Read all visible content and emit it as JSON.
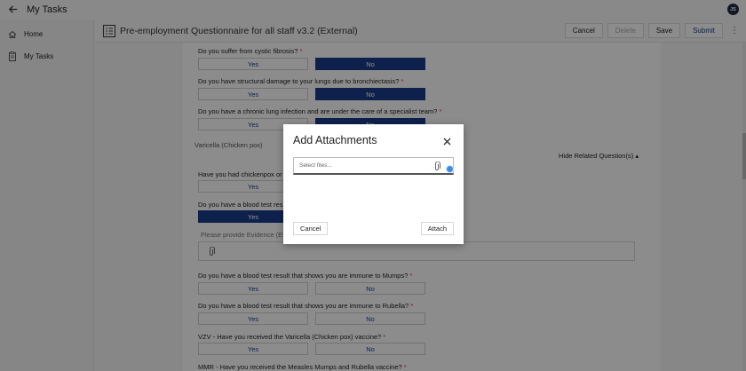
{
  "topbar": {
    "title": "My Tasks",
    "avatar_initials": "JS"
  },
  "sidebar": {
    "items": [
      {
        "label": "Home",
        "icon": "home-icon"
      },
      {
        "label": "My Tasks",
        "icon": "clipboard-icon"
      }
    ]
  },
  "header": {
    "form_title": "Pre-employment Questionnaire for all staff v3.2 (External)",
    "buttons": {
      "cancel": "Cancel",
      "delete": "Delete",
      "save": "Save",
      "submit": "Submit"
    }
  },
  "form": {
    "questions": [
      {
        "text": "Do you suffer from cystic fibrosis?",
        "required": "*",
        "yes": "Yes",
        "no": "No",
        "selected": "no"
      },
      {
        "text": "Do you have structural damage to your lungs due to bronchiectasis?",
        "required": "*",
        "yes": "Yes",
        "no": "No",
        "selected": "no"
      },
      {
        "text": "Do you have a chronic lung infection and are under the care of a specialist team?",
        "required": "*",
        "yes": "Yes",
        "no": "No",
        "selected": "no"
      },
      {
        "text": "Have you had chickenpox or s",
        "required": "",
        "yes": "Yes",
        "no": "No",
        "selected": "none"
      },
      {
        "text": "Do you have a blood test resul",
        "required": "",
        "yes": "Yes",
        "no": "No",
        "selected": "yes"
      },
      {
        "text": "Do you have a blood test result that shows you are immune to Mumps?",
        "required": "*",
        "yes": "Yes",
        "no": "No",
        "selected": "none"
      },
      {
        "text": "Do you have a blood test result that shows you are immune to Rubella?",
        "required": "*",
        "yes": "Yes",
        "no": "No",
        "selected": "none"
      },
      {
        "text": "VZV - Have you received the Varicella (Chicken pox) vaccine?",
        "required": "*",
        "yes": "Yes",
        "no": "No",
        "selected": "none"
      },
      {
        "text": "MMR - Have you received the Measles Mumps and Rubella vaccine?",
        "required": "*"
      }
    ],
    "section_label": "Varicella (Chicken pox)",
    "hide_related": "Hide Related Question(s)",
    "evidence_label": "Please provide Evidence (Eve"
  },
  "modal": {
    "title": "Add Attachments",
    "placeholder": "Select files...",
    "cancel": "Cancel",
    "attach": "Attach"
  },
  "colors": {
    "accent": "#1a3c8c",
    "required": "#dd3333"
  }
}
